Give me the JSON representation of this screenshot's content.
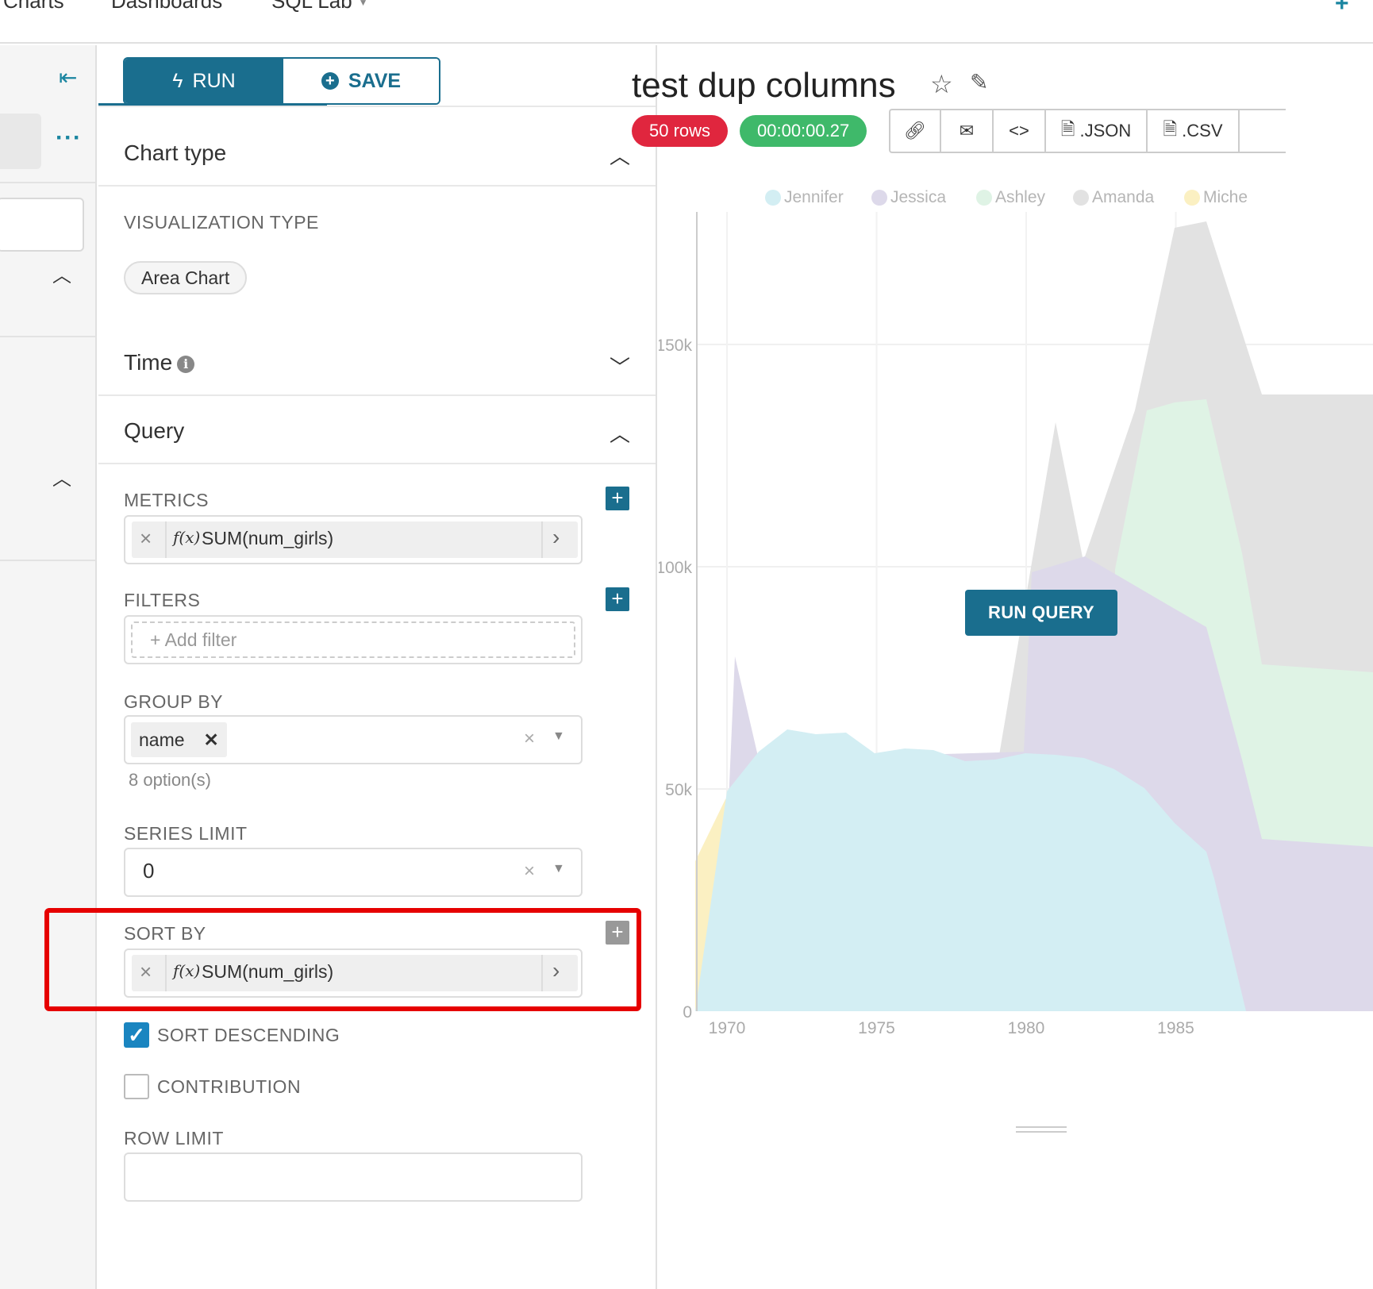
{
  "topnav": {
    "items": [
      "Charts",
      "Dashboards",
      "SQL Lab"
    ]
  },
  "run_label": "RUN",
  "save_label": "SAVE",
  "sections": {
    "chart_type": "Chart type",
    "time": "Time",
    "query": "Query"
  },
  "visualization": {
    "label": "VISUALIZATION TYPE",
    "value": "Area Chart"
  },
  "metrics": {
    "label": "METRICS",
    "item": "SUM(num_girls)",
    "fx": "f(x)"
  },
  "filters": {
    "label": "FILTERS",
    "placeholder": "Add filter"
  },
  "group_by": {
    "label": "GROUP BY",
    "tag": "name",
    "options_hint": "8 option(s)"
  },
  "series_limit": {
    "label": "SERIES LIMIT",
    "value": "0"
  },
  "sort_by": {
    "label": "SORT BY",
    "item": "SUM(num_girls)",
    "fx": "f(x)"
  },
  "sort_descending": {
    "label": "SORT DESCENDING",
    "checked": true
  },
  "contribution": {
    "label": "CONTRIBUTION",
    "checked": false
  },
  "row_limit": {
    "label": "ROW LIMIT"
  },
  "chart_header": {
    "title": "test dup columns",
    "rows_badge": "50 rows",
    "time_badge": "00:00:00.27",
    "json_label": ".JSON",
    "csv_label": ".CSV",
    "run_query_label": "RUN QUERY"
  },
  "colors": {
    "accent": "#1a6e8e",
    "highlight": "#e60000",
    "rows_badge": "#e0263e",
    "time_badge": "#3fb96a"
  },
  "chart_data": {
    "type": "area",
    "x": [
      1970,
      1975,
      1980,
      1985
    ],
    "x_ticks": [
      "1970",
      "1975",
      "1980",
      "1985"
    ],
    "y_ticks": [
      "0",
      "50k",
      "100k",
      "150k"
    ],
    "ylim": [
      0,
      150000
    ],
    "legend": [
      {
        "name": "Jennifer",
        "color": "#d3eef3"
      },
      {
        "name": "Jessica",
        "color": "#ddd9ea"
      },
      {
        "name": "Ashley",
        "color": "#dff3e5"
      },
      {
        "name": "Amanda",
        "color": "#e2e2e2"
      },
      {
        "name": "Miche",
        "color": "#fbf0c2"
      }
    ],
    "legend_placement": "top"
  }
}
